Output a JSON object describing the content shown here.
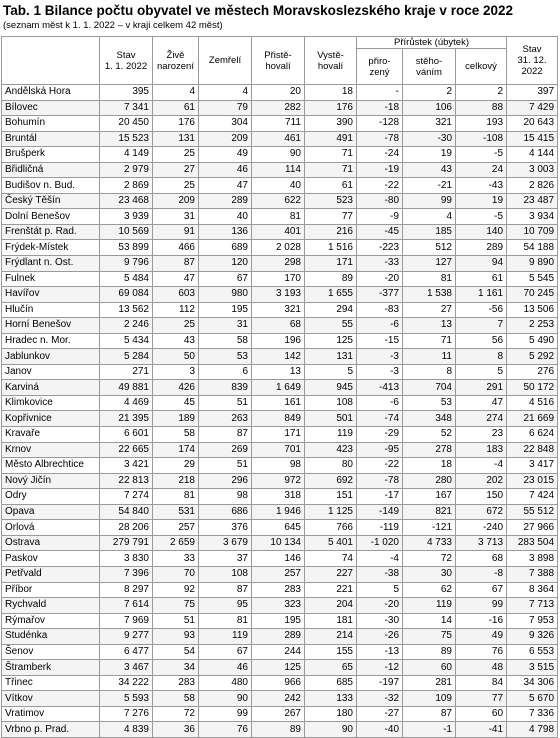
{
  "title": "Tab. 1 Bilance počtu obyvatel ve městech Moravskoslezského kraje v roce 2022",
  "subtitle": "(seznam měst k 1. 1. 2022 – v kraji celkem 42 měst)",
  "headers": {
    "stav_start_1": "Stav",
    "stav_start_2": "1. 1. 2022",
    "zive_1": "Živě",
    "zive_2": "narození",
    "zemreli": "Zemřelí",
    "pristehovali_1": "Přistě-",
    "pristehovali_2": "hovalí",
    "vystehovali_1": "Vystě-",
    "vystehovali_2": "hovalí",
    "prirustek": "Přírůstek (úbytek)",
    "prirozeny_1": "přiro-",
    "prirozeny_2": "zený",
    "stehovanim_1": "stěho-",
    "stehovanim_2": "váním",
    "celkovy": "celkový",
    "stav_end_1": "Stav",
    "stav_end_2": "31. 12. 2022"
  },
  "rows": [
    [
      "Andělská Hora",
      "395",
      "4",
      "4",
      "20",
      "18",
      "-",
      "2",
      "2",
      "397"
    ],
    [
      "Bílovec",
      "7 341",
      "61",
      "79",
      "282",
      "176",
      "-18",
      "106",
      "88",
      "7 429"
    ],
    [
      "Bohumín",
      "20 450",
      "176",
      "304",
      "711",
      "390",
      "-128",
      "321",
      "193",
      "20 643"
    ],
    [
      "Bruntál",
      "15 523",
      "131",
      "209",
      "461",
      "491",
      "-78",
      "-30",
      "-108",
      "15 415"
    ],
    [
      "Brušperk",
      "4 149",
      "25",
      "49",
      "90",
      "71",
      "-24",
      "19",
      "-5",
      "4 144"
    ],
    [
      "Břidličná",
      "2 979",
      "27",
      "46",
      "114",
      "71",
      "-19",
      "43",
      "24",
      "3 003"
    ],
    [
      "Budišov n. Bud.",
      "2 869",
      "25",
      "47",
      "40",
      "61",
      "-22",
      "-21",
      "-43",
      "2 826"
    ],
    [
      "Český Těšín",
      "23 468",
      "209",
      "289",
      "622",
      "523",
      "-80",
      "99",
      "19",
      "23 487"
    ],
    [
      "Dolní Benešov",
      "3 939",
      "31",
      "40",
      "81",
      "77",
      "-9",
      "4",
      "-5",
      "3 934"
    ],
    [
      "Frenštát p. Rad.",
      "10 569",
      "91",
      "136",
      "401",
      "216",
      "-45",
      "185",
      "140",
      "10 709"
    ],
    [
      "Frýdek-Místek",
      "53 899",
      "466",
      "689",
      "2 028",
      "1 516",
      "-223",
      "512",
      "289",
      "54 188"
    ],
    [
      "Frýdlant n. Ost.",
      "9 796",
      "87",
      "120",
      "298",
      "171",
      "-33",
      "127",
      "94",
      "9 890"
    ],
    [
      "Fulnek",
      "5 484",
      "47",
      "67",
      "170",
      "89",
      "-20",
      "81",
      "61",
      "5 545"
    ],
    [
      "Havířov",
      "69 084",
      "603",
      "980",
      "3 193",
      "1 655",
      "-377",
      "1 538",
      "1 161",
      "70 245"
    ],
    [
      "Hlučín",
      "13 562",
      "112",
      "195",
      "321",
      "294",
      "-83",
      "27",
      "-56",
      "13 506"
    ],
    [
      "Horní Benešov",
      "2 246",
      "25",
      "31",
      "68",
      "55",
      "-6",
      "13",
      "7",
      "2 253"
    ],
    [
      "Hradec n. Mor.",
      "5 434",
      "43",
      "58",
      "196",
      "125",
      "-15",
      "71",
      "56",
      "5 490"
    ],
    [
      "Jablunkov",
      "5 284",
      "50",
      "53",
      "142",
      "131",
      "-3",
      "11",
      "8",
      "5 292"
    ],
    [
      "Janov",
      "271",
      "3",
      "6",
      "13",
      "5",
      "-3",
      "8",
      "5",
      "276"
    ],
    [
      "Karviná",
      "49 881",
      "426",
      "839",
      "1 649",
      "945",
      "-413",
      "704",
      "291",
      "50 172"
    ],
    [
      "Klimkovice",
      "4 469",
      "45",
      "51",
      "161",
      "108",
      "-6",
      "53",
      "47",
      "4 516"
    ],
    [
      "Kopřivnice",
      "21 395",
      "189",
      "263",
      "849",
      "501",
      "-74",
      "348",
      "274",
      "21 669"
    ],
    [
      "Kravaře",
      "6 601",
      "58",
      "87",
      "171",
      "119",
      "-29",
      "52",
      "23",
      "6 624"
    ],
    [
      "Krnov",
      "22 665",
      "174",
      "269",
      "701",
      "423",
      "-95",
      "278",
      "183",
      "22 848"
    ],
    [
      "Město Albrechtice",
      "3 421",
      "29",
      "51",
      "98",
      "80",
      "-22",
      "18",
      "-4",
      "3 417"
    ],
    [
      "Nový Jičín",
      "22 813",
      "218",
      "296",
      "972",
      "692",
      "-78",
      "280",
      "202",
      "23 015"
    ],
    [
      "Odry",
      "7 274",
      "81",
      "98",
      "318",
      "151",
      "-17",
      "167",
      "150",
      "7 424"
    ],
    [
      "Opava",
      "54 840",
      "531",
      "686",
      "1 946",
      "1 125",
      "-149",
      "821",
      "672",
      "55 512"
    ],
    [
      "Orlová",
      "28 206",
      "257",
      "376",
      "645",
      "766",
      "-119",
      "-121",
      "-240",
      "27 966"
    ],
    [
      "Ostrava",
      "279 791",
      "2 659",
      "3 679",
      "10 134",
      "5 401",
      "-1 020",
      "4 733",
      "3 713",
      "283 504"
    ],
    [
      "Paskov",
      "3 830",
      "33",
      "37",
      "146",
      "74",
      "-4",
      "72",
      "68",
      "3 898"
    ],
    [
      "Petřvald",
      "7 396",
      "70",
      "108",
      "257",
      "227",
      "-38",
      "30",
      "-8",
      "7 388"
    ],
    [
      "Příbor",
      "8 297",
      "92",
      "87",
      "283",
      "221",
      "5",
      "62",
      "67",
      "8 364"
    ],
    [
      "Rychvald",
      "7 614",
      "75",
      "95",
      "323",
      "204",
      "-20",
      "119",
      "99",
      "7 713"
    ],
    [
      "Rýmařov",
      "7 969",
      "51",
      "81",
      "195",
      "181",
      "-30",
      "14",
      "-16",
      "7 953"
    ],
    [
      "Studénka",
      "9 277",
      "93",
      "119",
      "289",
      "214",
      "-26",
      "75",
      "49",
      "9 326"
    ],
    [
      "Šenov",
      "6 477",
      "54",
      "67",
      "244",
      "155",
      "-13",
      "89",
      "76",
      "6 553"
    ],
    [
      "Štramberk",
      "3 467",
      "34",
      "46",
      "125",
      "65",
      "-12",
      "60",
      "48",
      "3 515"
    ],
    [
      "Třinec",
      "34 222",
      "283",
      "480",
      "966",
      "685",
      "-197",
      "281",
      "84",
      "34 306"
    ],
    [
      "Vítkov",
      "5 593",
      "58",
      "90",
      "242",
      "133",
      "-32",
      "109",
      "77",
      "5 670"
    ],
    [
      "Vratimov",
      "7 276",
      "72",
      "99",
      "267",
      "180",
      "-27",
      "87",
      "60",
      "7 336"
    ],
    [
      "Vrbno p. Prad.",
      "4 839",
      "36",
      "76",
      "89",
      "90",
      "-40",
      "-1",
      "-41",
      "4 798"
    ]
  ]
}
